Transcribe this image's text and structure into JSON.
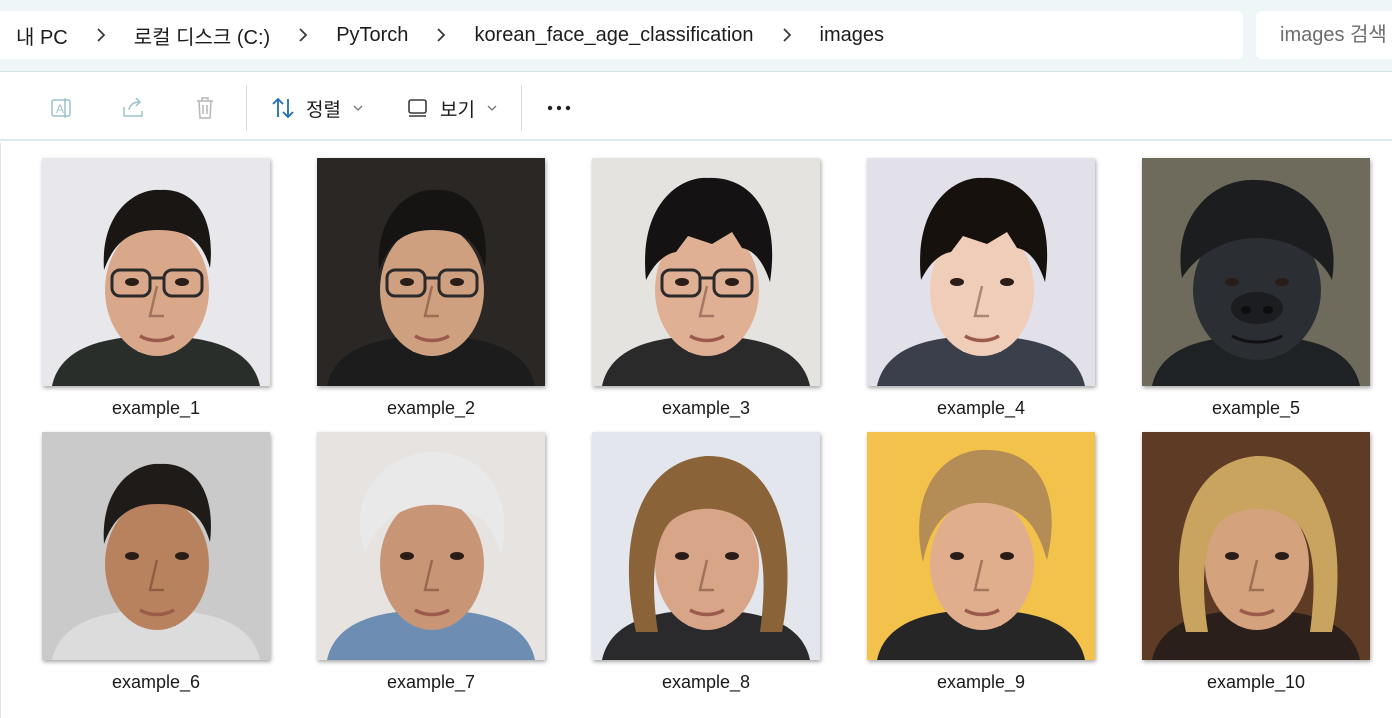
{
  "address_bar": {
    "breadcrumbs": [
      "내 PC",
      "로컬 디스크 (C:)",
      "PyTorch",
      "korean_face_age_classification",
      "images"
    ],
    "separator_icon": "chevron-right-icon"
  },
  "search": {
    "placeholder": "images 검색"
  },
  "command_bar": {
    "rename_icon": "rename-icon",
    "share_icon": "share-icon",
    "delete_icon": "trash-icon",
    "sort": {
      "icon": "sort-arrows-icon",
      "label": "정렬"
    },
    "view": {
      "icon": "view-layout-icon",
      "label": "보기"
    },
    "more_icon": "more-options-icon"
  },
  "files": [
    {
      "name": "example_1",
      "bg": "#e8e8ec",
      "skin": "#d9a88a",
      "hair": "#1a1614",
      "shirt": "#2a2e2a",
      "glasses": true,
      "hair_style": "short"
    },
    {
      "name": "example_2",
      "bg": "#2a2724",
      "skin": "#cfa080",
      "hair": "#161412",
      "shirt": "#1c1c1c",
      "glasses": true,
      "hair_style": "short"
    },
    {
      "name": "example_3",
      "bg": "#e5e3e0",
      "skin": "#e0b095",
      "hair": "#141212",
      "shirt": "#2a2a2a",
      "glasses": true,
      "hair_style": "bowl"
    },
    {
      "name": "example_4",
      "bg": "#e2e1ea",
      "skin": "#f0cdb8",
      "hair": "#17110e",
      "shirt": "#3b3f4c",
      "glasses": false,
      "hair_style": "bowl"
    },
    {
      "name": "example_5",
      "bg": "#6e6a5c",
      "skin": "#2b2f33",
      "hair": "#1b1d1f",
      "shirt": "#1f2224",
      "glasses": false,
      "hair_style": "gorilla"
    },
    {
      "name": "example_6",
      "bg": "#c9cac9",
      "skin": "#b9825e",
      "hair": "#1f1b19",
      "shirt": "#dcdcdc",
      "glasses": false,
      "hair_style": "short"
    },
    {
      "name": "example_7",
      "bg": "#e6e3e0",
      "skin": "#c99577",
      "hair": "#e9e9e9",
      "shirt": "#6d8db3",
      "glasses": false,
      "hair_style": "fluffy"
    },
    {
      "name": "example_8",
      "bg": "#e4e6ee",
      "skin": "#d9a589",
      "hair": "#8a6339",
      "shirt": "#2a2a2c",
      "glasses": false,
      "hair_style": "long"
    },
    {
      "name": "example_9",
      "bg": "#f2c24a",
      "skin": "#e0ad8d",
      "hair": "#b48c55",
      "shirt": "#262626",
      "glasses": false,
      "hair_style": "swept"
    },
    {
      "name": "example_10",
      "bg": "#5e3b25",
      "skin": "#d4a27c",
      "hair": "#c9a45f",
      "shirt": "#2a1f1a",
      "glasses": false,
      "hair_style": "long"
    }
  ]
}
